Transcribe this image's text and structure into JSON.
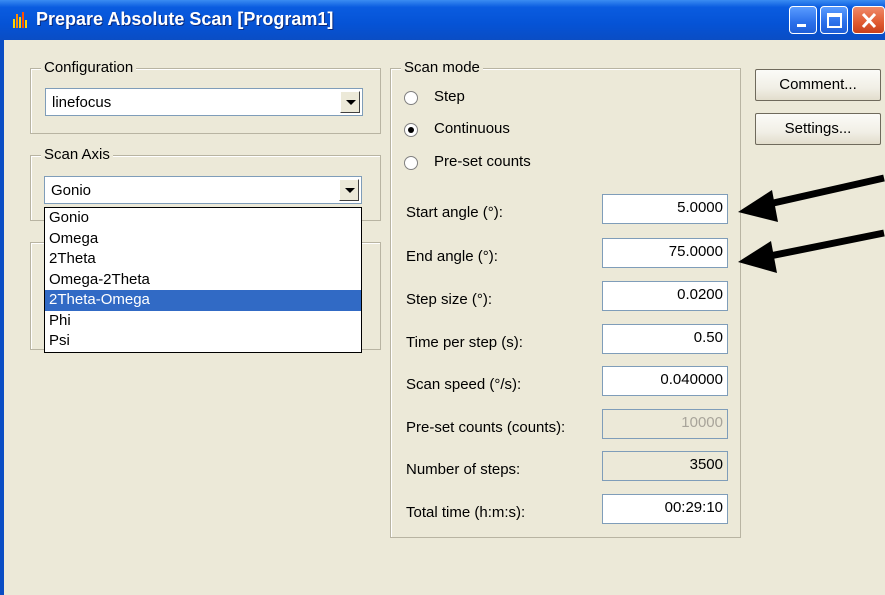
{
  "window": {
    "title": "Prepare Absolute Scan [Program1]",
    "icon": "spectrum-app-icon",
    "controls": [
      "minimize-icon",
      "maximize-icon",
      "close-icon"
    ]
  },
  "configuration": {
    "title": "Configuration",
    "value": "linefocus"
  },
  "scan_axis": {
    "title": "Scan Axis",
    "value": "Gonio",
    "options": [
      "Gonio",
      "Omega",
      "2Theta",
      "Omega-2Theta",
      "2Theta-Omega",
      "Phi",
      "Psi"
    ],
    "highlighted": "2Theta-Omega"
  },
  "scan_mode": {
    "title": "Scan mode",
    "options": [
      {
        "label": "Step",
        "selected": false
      },
      {
        "label": "Continuous",
        "selected": true
      },
      {
        "label": "Pre-set counts",
        "selected": false
      }
    ]
  },
  "parameters": [
    {
      "label": "Start angle (°):",
      "value": "5.0000",
      "state": "editable"
    },
    {
      "label": "End angle (°):",
      "value": "75.0000",
      "state": "editable"
    },
    {
      "label": "Step size (°):",
      "value": "0.0200",
      "state": "editable"
    },
    {
      "label": "Time per step (s):",
      "value": "0.50",
      "state": "editable"
    },
    {
      "label": "Scan speed (°/s):",
      "value": "0.040000",
      "state": "editable"
    },
    {
      "label": "Pre-set counts (counts):",
      "value": "10000",
      "state": "disabled"
    },
    {
      "label": "Number of steps:",
      "value": "3500",
      "state": "readonly"
    },
    {
      "label": "Total time (h:m:s):",
      "value": "00:29:10",
      "state": "editable"
    }
  ],
  "buttons": {
    "comment": "Comment...",
    "settings": "Settings..."
  },
  "colors": {
    "titlebar": "#0553d6",
    "dialog_bg": "#ece9d8",
    "selection": "#316ac5"
  }
}
